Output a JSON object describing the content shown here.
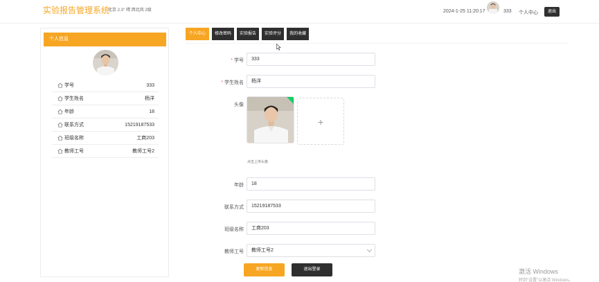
{
  "header": {
    "app_title": "实验报告管理系统",
    "weather": "北京  2.3°  晴  西北风  2级",
    "datetime": "2024-1-25 11:20:17",
    "username": "333",
    "personal_center": "个人中心",
    "logout": "退出"
  },
  "profile_card": {
    "title": "个人信息",
    "items": [
      {
        "label": "学号",
        "value": "333"
      },
      {
        "label": "学生姓名",
        "value": "杨洋"
      },
      {
        "label": "年龄",
        "value": "18"
      },
      {
        "label": "联系方式",
        "value": "15219187533"
      },
      {
        "label": "班级名称",
        "value": "工商203"
      },
      {
        "label": "教师工号",
        "value": "教师工号2"
      }
    ]
  },
  "tabs": [
    {
      "label": "个人中心",
      "active": true
    },
    {
      "label": "修改密码",
      "active": false
    },
    {
      "label": "实验报告",
      "active": false
    },
    {
      "label": "实验评分",
      "active": false
    },
    {
      "label": "我的收藏",
      "active": false
    }
  ],
  "form": {
    "student_no": {
      "label": "学号",
      "value": "333"
    },
    "student_name": {
      "label": "学生姓名",
      "value": "杨洋"
    },
    "avatar": {
      "label": "头像",
      "tip": "点击上传头像"
    },
    "age": {
      "label": "年龄",
      "value": "18"
    },
    "phone": {
      "label": "联系方式",
      "value": "15219187533"
    },
    "class_name": {
      "label": "班级名称",
      "value": "工商203"
    },
    "teacher_no": {
      "label": "教师工号",
      "value": "教师工号2"
    },
    "update_button": "更新信息",
    "logout_button": "退出登录"
  },
  "watermark": {
    "line1": "激活 Windows",
    "line2": "转到\"设置\"以激活 Windows。"
  },
  "colors": {
    "accent": "#f6a623",
    "dark": "#2f2f2f",
    "required": "#f56c6c",
    "success": "#13ce66"
  }
}
